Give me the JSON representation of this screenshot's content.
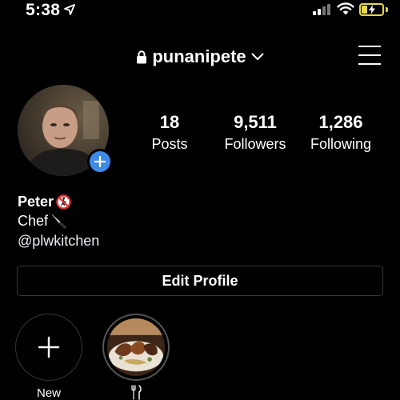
{
  "status_bar": {
    "time": "5:38",
    "location_icon": "location-arrow-icon",
    "signal_icon": "cellular-signal-icon",
    "wifi_icon": "wifi-icon",
    "battery_icon": "battery-charging-icon",
    "battery_level": 0.25,
    "battery_color": "#e6d84a"
  },
  "header": {
    "username": "punanipete",
    "lock_icon": "lock-icon",
    "chevron_icon": "chevron-down-icon",
    "menu_icon": "hamburger-menu-icon"
  },
  "profile": {
    "avatar_icon": "avatar",
    "add_story_icon": "plus-icon",
    "add_story_color": "#3f8ae8",
    "stats": {
      "posts": {
        "value": "18",
        "label": "Posts"
      },
      "followers": {
        "value": "9,511",
        "label": "Followers"
      },
      "following": {
        "value": "1,286",
        "label": "Following"
      }
    },
    "bio": {
      "name": "Peter",
      "name_emoji": "no-pedestrians-icon",
      "line1": "Chef",
      "line1_emoji": "kitchen-knife-icon",
      "link": "@plwkitchen"
    }
  },
  "actions": {
    "edit_profile": "Edit Profile"
  },
  "highlights": [
    {
      "label": "New",
      "icon": "plus-icon"
    },
    {
      "label": "",
      "icon": "fork-and-knife-icon"
    }
  ]
}
